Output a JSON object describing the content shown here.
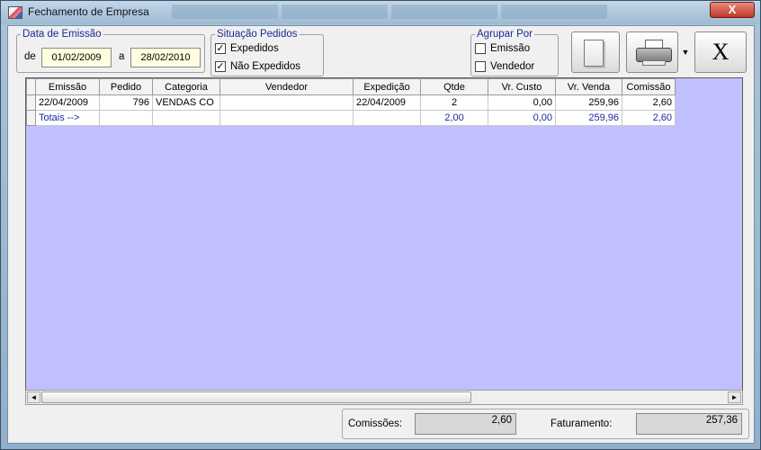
{
  "window": {
    "title": "Fechamento de Empresa",
    "close_label": "X"
  },
  "data_emissao": {
    "legend": "Data de Emissão",
    "from_label": "de",
    "from_value": "01/02/2009",
    "to_label": "a",
    "to_value": "28/02/2010"
  },
  "situacao": {
    "legend": "Situação Pedidos",
    "options": [
      {
        "label": "Expedidos",
        "checked": true
      },
      {
        "label": "Não Expedidos",
        "checked": true
      }
    ]
  },
  "agrupar": {
    "legend": "Agrupar Por",
    "options": [
      {
        "label": "Emissão",
        "checked": false
      },
      {
        "label": "Vendedor",
        "checked": false
      }
    ]
  },
  "toolbar": {
    "close_glyph": "X",
    "dropdown_glyph": "▼",
    "check_glyph": "✓"
  },
  "grid": {
    "columns": [
      "Emissão",
      "Pedido",
      "Categoria",
      "Vendedor",
      "Expedição",
      "Qtde",
      "Vr. Custo",
      "Vr. Venda",
      "Comissão"
    ],
    "rows": [
      {
        "emissao": "22/04/2009",
        "pedido": "796",
        "categoria": "VENDAS CO",
        "vendedor": "",
        "expedicao": "22/04/2009",
        "qtde": "2",
        "custo": "0,00",
        "venda": "259,96",
        "comissao": "2,60"
      }
    ],
    "totals": {
      "label": "Totais -->",
      "qtde": "2,00",
      "custo": "0,00",
      "venda": "259,96",
      "comissao": "2,60"
    }
  },
  "scroll": {
    "left_arrow": "◄",
    "right_arrow": "►"
  },
  "footer": {
    "comissoes_label": "Comissões:",
    "comissoes_value": "2,60",
    "faturamento_label": "Faturamento:",
    "faturamento_value": "257,36"
  }
}
